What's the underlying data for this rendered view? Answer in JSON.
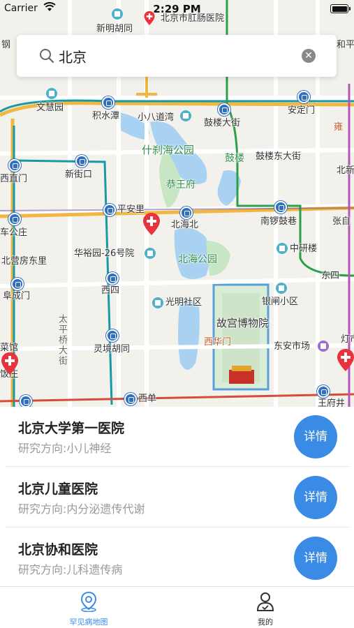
{
  "status_bar": {
    "carrier": "Carrier",
    "time": "2:29 PM"
  },
  "search": {
    "value": "北京",
    "placeholder": ""
  },
  "map": {
    "labels": {
      "xinmingHutong": "新明胡同",
      "gangchangHospital": "北京市肛肠医院",
      "wenshengYuan": "文慧园",
      "jishuitan": "积水潭",
      "xiaobadaowan": "小八道湾",
      "gulouDajie": "鼓楼大街",
      "andingmen": "安定门",
      "shichahaiPark": "什刹海公园",
      "gulou": "鼓楼",
      "gulouDongDajie": "鼓楼东大街",
      "xizhimen": "西直门",
      "xinjiekou": "新街口",
      "gongwangfu": "恭王府",
      "pinganli": "平安里",
      "beihaibei": "北海北",
      "nanluoguxiang": "南锣鼓巷",
      "chegongzhuang": "车公庄",
      "huayuyuan": "华裕园-26号院",
      "zhongyanlou": "中研楼",
      "beiyingfangdongli": "北营房东里",
      "beihaiPark": "北海公园",
      "dongsi": "东四",
      "fuchengmen": "阜成门",
      "xisi": "西四",
      "guangmingshequ": "光明社区",
      "yinzhaxiaoqu": "银闸小区",
      "taipingqiaoDajie": "太平桥大街",
      "gugongMuseum": "故宫博物院",
      "lingjingHutong": "灵境胡同",
      "xihuamen": "西华门",
      "dongan": "东安市场",
      "xidan": "西单",
      "wangfujing": "王府井",
      "zhangzi": "张自",
      "beixin": "北新",
      "yonghe": "和平",
      "gang": "钢",
      "caiguan": "菜馆",
      "fandian": "饭庄",
      "dengshi": "灯市",
      "gongong": "雍"
    }
  },
  "hospitals": [
    {
      "name": "北京大学第一医院",
      "direction": "研究方向:小儿神经",
      "detail_label": "详情"
    },
    {
      "name": "北京儿童医院",
      "direction": "研究方向:内分泌遗传代谢",
      "detail_label": "详情"
    },
    {
      "name": "北京协和医院",
      "direction": "研究方向:儿科遗传病",
      "detail_label": "详情"
    }
  ],
  "tabs": {
    "map_label": "罕见病地图",
    "me_label": "我的"
  },
  "colors": {
    "accent": "#3a8be6",
    "metro": "#2f6fbd",
    "pin": "#e8323c"
  }
}
